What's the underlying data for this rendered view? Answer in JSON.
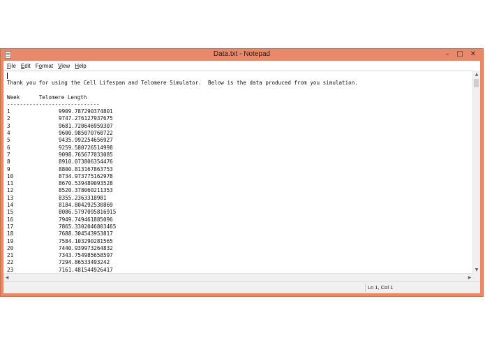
{
  "window": {
    "title": "Data.txt - Notepad"
  },
  "menu": [
    {
      "accel": "F",
      "rest": "ile"
    },
    {
      "accel": "E",
      "rest": "dit"
    },
    {
      "pre": "F",
      "accel": "o",
      "rest": "rmat"
    },
    {
      "accel": "V",
      "rest": "iew"
    },
    {
      "accel": "H",
      "rest": "elp"
    }
  ],
  "editor": {
    "intro": "Thank you for using the Cell Lifespan and Telomere Simulator.  Below is the data produced from you simulation.",
    "header": "Week      Telomere Length",
    "separator": "-----------------------------",
    "rows": [
      [
        "1",
        "9909.787290374801"
      ],
      [
        "2",
        "9747.276127937675"
      ],
      [
        "3",
        "9681.720646959307"
      ],
      [
        "4",
        "9600.985070760722"
      ],
      [
        "5",
        "9435.992254656927"
      ],
      [
        "6",
        "9259.580726514998"
      ],
      [
        "7",
        "9098.765677033085"
      ],
      [
        "8",
        "8910.073806354476"
      ],
      [
        "9",
        "8800.813167863753"
      ],
      [
        "10",
        "8734.973775162978"
      ],
      [
        "11",
        "8670.539489093528"
      ],
      [
        "12",
        "8520.378060211353"
      ],
      [
        "13",
        "8355.2363318981"
      ],
      [
        "14",
        "8184.804292530869"
      ],
      [
        "15",
        "8086.5797095816915"
      ],
      [
        "16",
        "7949.749461885096"
      ],
      [
        "17",
        "7865.3302046803465"
      ],
      [
        "18",
        "7688.304543953817"
      ],
      [
        "19",
        "7584.103290281565"
      ],
      [
        "20",
        "7440.939973264832"
      ],
      [
        "21",
        "7343.754985658597"
      ],
      [
        "22",
        "7294.86533493242"
      ],
      [
        "23",
        "7161.481544926417"
      ]
    ]
  },
  "status": {
    "position": "Ln 1, Col 1"
  },
  "icons": {
    "minimize": "minimize-icon",
    "maximize": "maximize-icon",
    "close": "close-icon",
    "scroll_up": "arrow-up-icon",
    "scroll_down": "arrow-down-icon",
    "scroll_left": "arrow-left-icon",
    "scroll_right": "arrow-right-icon"
  }
}
